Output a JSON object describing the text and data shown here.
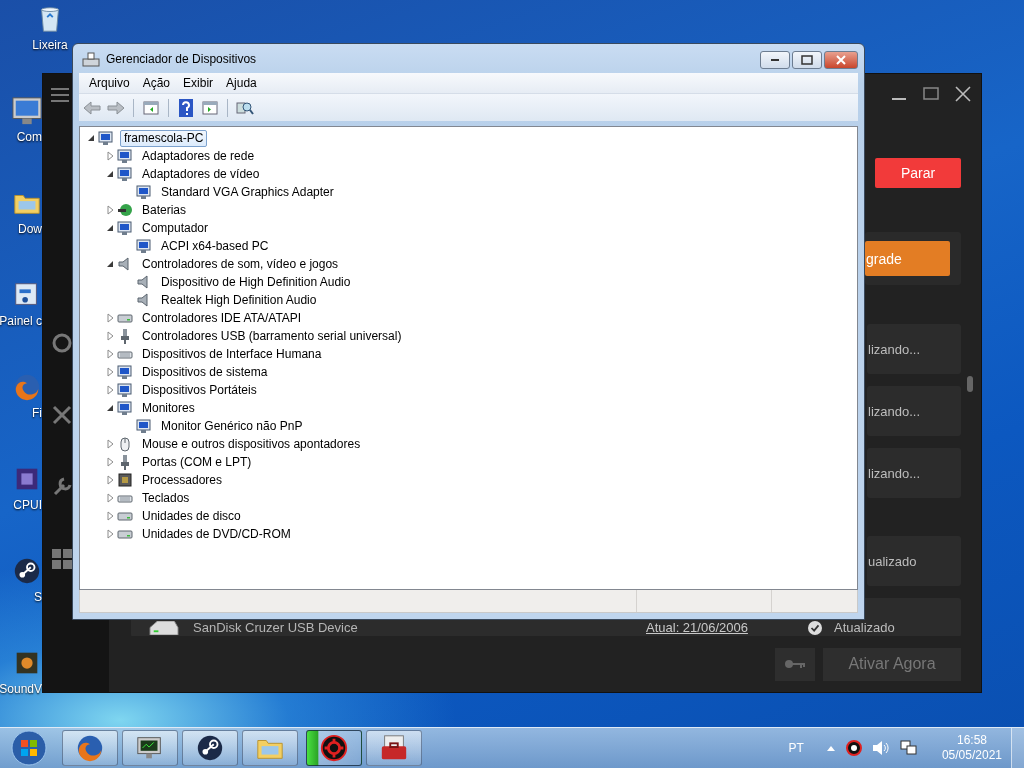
{
  "desktop": {
    "icons": [
      {
        "kind": "recycle",
        "label": "Lixeira"
      },
      {
        "kind": "computer",
        "label": "Com"
      },
      {
        "kind": "folder",
        "label": "Dow"
      },
      {
        "kind": "panel",
        "label": "Painel c"
      },
      {
        "kind": "firefox",
        "label": "Fi"
      },
      {
        "kind": "cpu",
        "label": "CPUI"
      },
      {
        "kind": "steam",
        "label": "S"
      },
      {
        "kind": "sound",
        "label": "SoundV"
      }
    ]
  },
  "background_app": {
    "stop_button": "Parar",
    "upgrade_button": "grade",
    "row_groups": [
      {
        "rows": [
          {
            "kind": "status",
            "status": "lizando..."
          },
          {
            "kind": "status",
            "status": "lizando..."
          },
          {
            "kind": "status",
            "status": "lizando..."
          }
        ]
      },
      {
        "rows": [
          {
            "kind": "status",
            "status": "ualizado"
          },
          {
            "kind": "device",
            "device": "SanDisk Cruzer USB Device",
            "version_link": "Atual: 21/06/2006",
            "status": "Atualizado"
          }
        ]
      }
    ],
    "activate_button": "Ativar Agora"
  },
  "device_manager": {
    "title": "Gerenciador de Dispositivos",
    "menu": [
      "Arquivo",
      "Ação",
      "Exibir",
      "Ajuda"
    ],
    "tree": {
      "label": "framescola-PC",
      "kind": "computer",
      "expanded": true,
      "selected": true,
      "children": [
        {
          "label": "Adaptadores de rede",
          "kind": "network",
          "expanded": false,
          "selected": false
        },
        {
          "label": "Adaptadores de vídeo",
          "kind": "display",
          "expanded": true,
          "selected": false,
          "children": [
            {
              "label": "Standard VGA Graphics Adapter",
              "kind": "display",
              "selected": false
            }
          ]
        },
        {
          "label": "Baterias",
          "kind": "battery",
          "expanded": false,
          "selected": false
        },
        {
          "label": "Computador",
          "kind": "computer",
          "expanded": true,
          "selected": false,
          "children": [
            {
              "label": "ACPI x64-based PC",
              "kind": "computer",
              "selected": false
            }
          ]
        },
        {
          "label": "Controladores de som, vídeo e jogos",
          "kind": "sound",
          "expanded": true,
          "selected": false,
          "children": [
            {
              "label": "Dispositivo de High Definition Audio",
              "kind": "sound",
              "selected": false
            },
            {
              "label": "Realtek High Definition Audio",
              "kind": "sound",
              "selected": false
            }
          ]
        },
        {
          "label": "Controladores IDE ATA/ATAPI",
          "kind": "drive",
          "expanded": false,
          "selected": false
        },
        {
          "label": "Controladores USB (barramento serial universal)",
          "kind": "plug",
          "expanded": false,
          "selected": false
        },
        {
          "label": "Dispositivos de Interface Humana",
          "kind": "keyboard",
          "expanded": false,
          "selected": false
        },
        {
          "label": "Dispositivos de sistema",
          "kind": "display",
          "expanded": false,
          "selected": false
        },
        {
          "label": "Dispositivos Portáteis",
          "kind": "display",
          "expanded": false,
          "selected": false
        },
        {
          "label": "Monitores",
          "kind": "display",
          "expanded": true,
          "selected": false,
          "children": [
            {
              "label": "Monitor Genérico não PnP",
              "kind": "display",
              "selected": false
            }
          ]
        },
        {
          "label": "Mouse e outros dispositivos apontadores",
          "kind": "mouse",
          "expanded": false,
          "selected": false
        },
        {
          "label": "Portas (COM e LPT)",
          "kind": "plug",
          "expanded": false,
          "selected": false
        },
        {
          "label": "Processadores",
          "kind": "chip",
          "expanded": false,
          "selected": false
        },
        {
          "label": "Teclados",
          "kind": "keyboard",
          "expanded": false,
          "selected": false
        },
        {
          "label": "Unidades de disco",
          "kind": "drive",
          "expanded": false,
          "selected": false
        },
        {
          "label": "Unidades de DVD/CD-ROM",
          "kind": "drive",
          "expanded": false,
          "selected": false
        }
      ]
    }
  },
  "taskbar": {
    "apps": [
      {
        "kind": "firefox",
        "active": false
      },
      {
        "kind": "monitor",
        "active": false
      },
      {
        "kind": "steam",
        "active": false
      },
      {
        "kind": "folder",
        "active": false
      },
      {
        "kind": "booster",
        "active": true
      },
      {
        "kind": "toolbox",
        "active": false
      }
    ],
    "tray": {
      "language": "PT",
      "time": "16:58",
      "date": "05/05/2021"
    }
  }
}
